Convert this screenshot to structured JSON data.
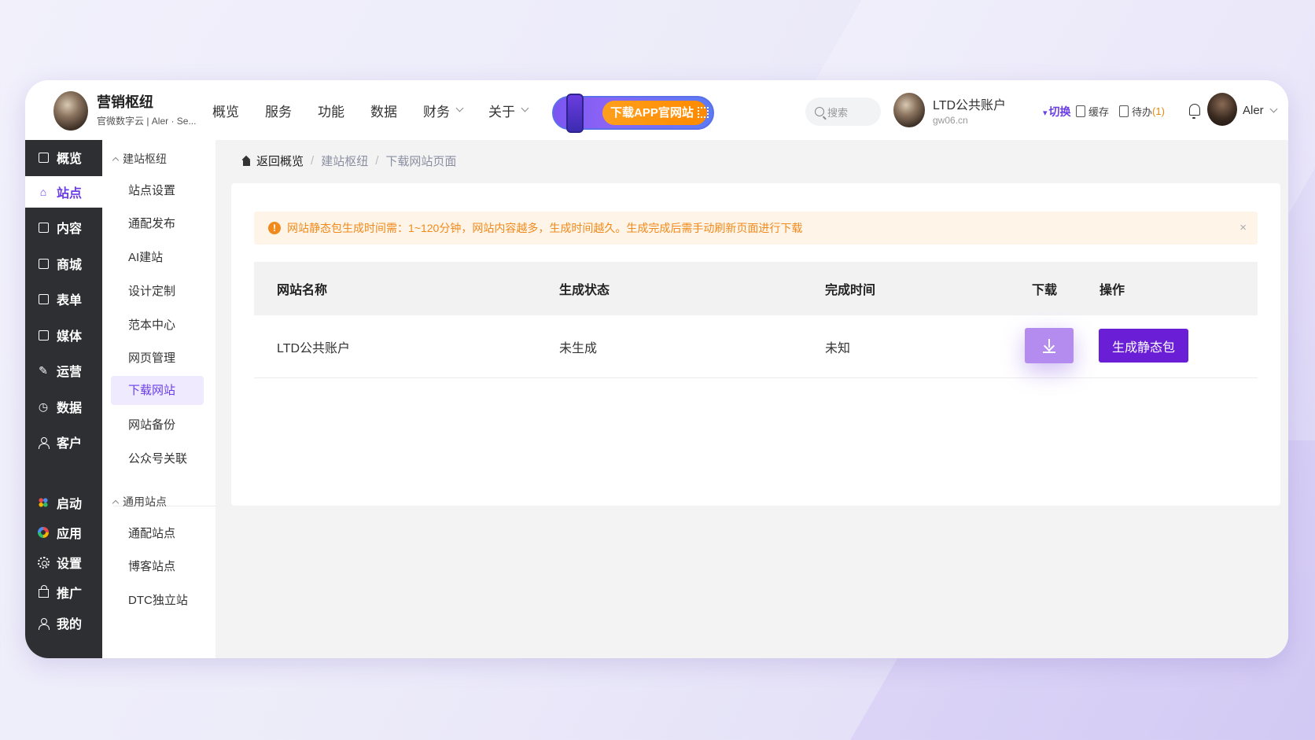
{
  "header": {
    "brand_name": "营销枢纽",
    "brand_sub": "官微数字云 | Aler · Se...",
    "nav": [
      {
        "label": "概览",
        "dropdown": false
      },
      {
        "label": "服务",
        "dropdown": false
      },
      {
        "label": "功能",
        "dropdown": false
      },
      {
        "label": "数据",
        "dropdown": false
      },
      {
        "label": "财务",
        "dropdown": true
      },
      {
        "label": "关于",
        "dropdown": true
      }
    ],
    "promo_label": "下载APP官网站",
    "search_placeholder": "搜索",
    "account_name": "LTD公共账户",
    "account_domain": "gw06.cn",
    "switch_label": "切换",
    "cache_label": "缓存",
    "todo_label": "待办",
    "todo_count": "(1)",
    "user_name": "Aler",
    "accent_color": "#6a3de8"
  },
  "sidebar": {
    "items": [
      {
        "label": "概览",
        "icon": "cart-icon"
      },
      {
        "label": "站点",
        "icon": "home-icon",
        "active": true
      },
      {
        "label": "内容",
        "icon": "document-icon"
      },
      {
        "label": "商城",
        "icon": "shop-icon"
      },
      {
        "label": "表单",
        "icon": "form-icon"
      },
      {
        "label": "媒体",
        "icon": "video-icon"
      },
      {
        "label": "运营",
        "icon": "tag-icon"
      },
      {
        "label": "数据",
        "icon": "chart-icon"
      },
      {
        "label": "客户",
        "icon": "person-icon"
      },
      {
        "label": "启动",
        "icon": "launch-icon"
      },
      {
        "label": "应用",
        "icon": "apps-icon"
      },
      {
        "label": "设置",
        "icon": "gear-icon"
      },
      {
        "label": "推广",
        "icon": "bag-icon"
      },
      {
        "label": "我的",
        "icon": "person-icon"
      }
    ]
  },
  "submenu": {
    "group1": "建站枢纽",
    "group1_items": [
      "站点设置",
      "通配发布",
      "AI建站",
      "设计定制",
      "范本中心",
      "网页管理",
      "下载网站",
      "网站备份",
      "公众号关联"
    ],
    "active_item": "下载网站",
    "group2": "通用站点",
    "group2_items": [
      "通配站点",
      "博客站点",
      "DTC独立站"
    ]
  },
  "breadcrumb": [
    "返回概览",
    "建站枢纽",
    "下载网站页面"
  ],
  "alert": {
    "text": "网站静态包生成时间需：1~120分钟，网站内容越多，生成时间越久。生成完成后需手动刷新页面进行下载",
    "close": "×"
  },
  "table": {
    "headers": [
      "网站名称",
      "生成状态",
      "完成时间",
      "下载",
      "操作"
    ],
    "rows": [
      {
        "name": "LTD公共账户",
        "status": "未生成",
        "time": "未知",
        "action": "生成静态包"
      }
    ]
  }
}
